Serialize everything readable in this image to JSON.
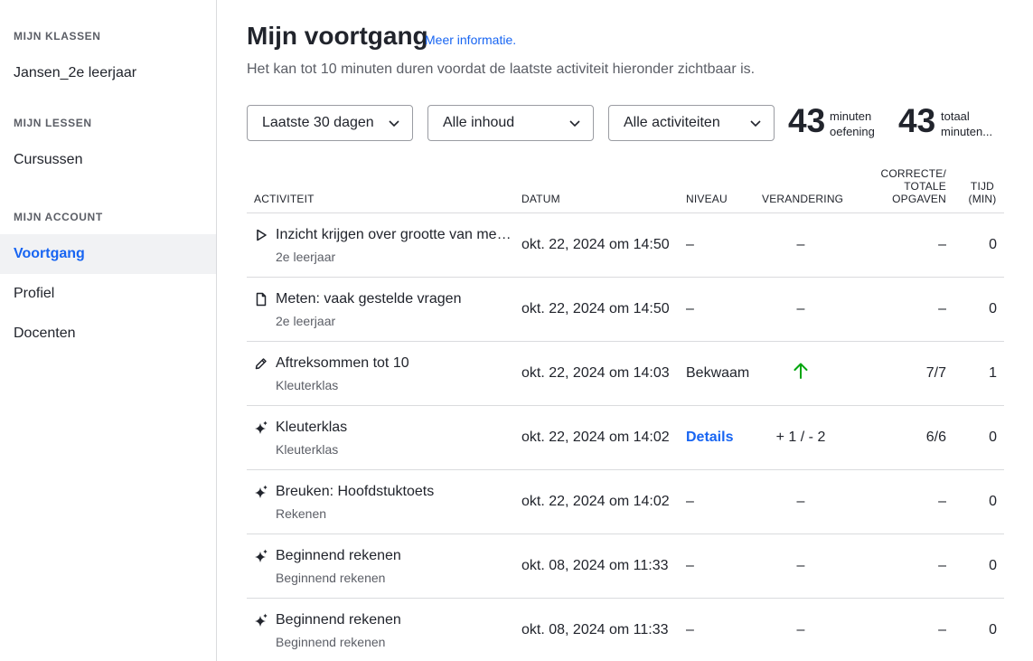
{
  "sidebar": {
    "classes_heading": "MIJN KLASSEN",
    "class_name": "Jansen_2e leerjaar",
    "lessons_heading": "MIJN LESSEN",
    "courses": "Cursussen",
    "account_heading": "MIJN ACCOUNT",
    "items": [
      {
        "label": "Voortgang",
        "active": true
      },
      {
        "label": "Profiel",
        "active": false
      },
      {
        "label": "Docenten",
        "active": false
      }
    ]
  },
  "header": {
    "title": "Mijn voortgang",
    "more_info": "Meer informatie.",
    "subtitle": "Het kan tot 10 minuten duren voordat de laatste activiteit hieronder zichtbaar is."
  },
  "filters": {
    "period": "Laatste 30 dagen",
    "content": "Alle inhoud",
    "activities": "Alle activiteiten"
  },
  "stats": {
    "practice_minutes": "43",
    "practice_label_1": "minuten",
    "practice_label_2": "oefening",
    "total_minutes": "43",
    "total_label_1": "totaal",
    "total_label_2": "minuten..."
  },
  "table": {
    "headers": {
      "activity": "ACTIVITEIT",
      "date": "DATUM",
      "level": "NIVEAU",
      "change": "VERANDERING",
      "correct_1": "CORRECTE/",
      "correct_2": "TOTALE",
      "correct_3": "OPGAVEN",
      "time_1": "TIJD",
      "time_2": "(MIN)"
    },
    "rows": [
      {
        "icon": "play-icon",
        "title": "Inzicht krijgen over grootte van meten",
        "subtitle": "2e leerjaar",
        "date": "okt. 22, 2024 om 14:50",
        "level": "–",
        "change": "–",
        "correct": "–",
        "time": "0"
      },
      {
        "icon": "document-icon",
        "title": "Meten: vaak gestelde vragen",
        "subtitle": "2e leerjaar",
        "date": "okt. 22, 2024 om 14:50",
        "level": "–",
        "change": "–",
        "correct": "–",
        "time": "0"
      },
      {
        "icon": "pencil-icon",
        "title": "Aftreksommen tot 10",
        "subtitle": "Kleuterklas",
        "date": "okt. 22, 2024 om 14:03",
        "level": "Bekwaam",
        "change": "",
        "correct": "7/7",
        "time": "1"
      },
      {
        "icon": "sparkle-icon",
        "title": "Kleuterklas",
        "subtitle": "Kleuterklas",
        "date": "okt. 22, 2024 om 14:02",
        "level": "Details",
        "change": "+ 1 / - 2",
        "correct": "6/6",
        "time": "0"
      },
      {
        "icon": "sparkle-icon",
        "title": "Breuken: Hoofdstuktoets",
        "subtitle": "Rekenen",
        "date": "okt. 22, 2024 om 14:02",
        "level": "–",
        "change": "–",
        "correct": "–",
        "time": "0"
      },
      {
        "icon": "sparkle-icon",
        "title": "Beginnend rekenen",
        "subtitle": "Beginnend rekenen",
        "date": "okt. 08, 2024 om 11:33",
        "level": "–",
        "change": "–",
        "correct": "–",
        "time": "0"
      },
      {
        "icon": "sparkle-icon",
        "title": "Beginnend rekenen",
        "subtitle": "Beginnend rekenen",
        "date": "okt. 08, 2024 om 11:33",
        "level": "–",
        "change": "–",
        "correct": "–",
        "time": "0"
      }
    ]
  },
  "colors": {
    "accent": "#1865f2",
    "up_arrow": "#00a60e"
  }
}
